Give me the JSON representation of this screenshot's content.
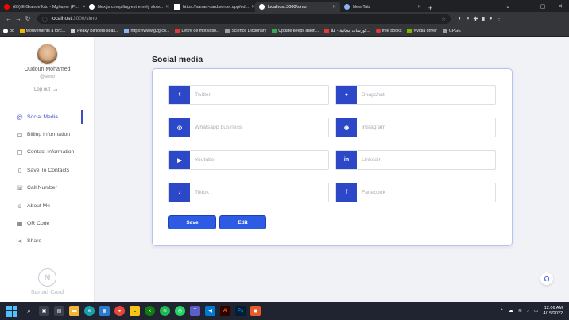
{
  "browser": {
    "tabs": [
      {
        "title": "(65) ElGrandeToto - Mghayer (Pr...",
        "active": false
      },
      {
        "title": "Nextjs compiling extremely slow...",
        "active": false
      },
      {
        "title": "https://sanad-card.vercel.app/ed...",
        "active": false
      },
      {
        "title": "localhost:3000/simo",
        "active": true
      },
      {
        "title": "New Tab",
        "active": false
      }
    ],
    "url_host": "localhost",
    "url_path": ":3000/simo",
    "bookmarks": [
      "pc",
      "Mouvements à forc...",
      "Peaky Blinders seas...",
      "https://www.g2g.co...",
      "Lettre de motivatio...",
      "Science Dictionary",
      "Update keeps askin...",
      "كورسات مجانية - علا...",
      "free books",
      "Nvidia driver",
      "CPGE"
    ]
  },
  "profile": {
    "name": "Oudoun Mohamed",
    "handle": "@simo",
    "logout_label": "Log out"
  },
  "nav": [
    {
      "label": "Social Media",
      "icon": "at-icon",
      "glyph": "@",
      "active": true
    },
    {
      "label": "Billing Information",
      "icon": "card-icon",
      "glyph": "▭",
      "active": false
    },
    {
      "label": "Contact Information",
      "icon": "chat-icon",
      "glyph": "▢",
      "active": false
    },
    {
      "label": "Save To Contacts",
      "icon": "phone-icon",
      "glyph": "▯",
      "active": false
    },
    {
      "label": "Call Number",
      "icon": "call-icon",
      "glyph": "☏",
      "active": false
    },
    {
      "label": "About Me",
      "icon": "user-icon",
      "glyph": "☺",
      "active": false
    },
    {
      "label": "QR Code",
      "icon": "qr-icon",
      "glyph": "▦",
      "active": false
    },
    {
      "label": "Share",
      "icon": "share-icon",
      "glyph": "⋖",
      "active": false
    }
  ],
  "brand": {
    "logo_letter": "N",
    "name": "Sanad Card"
  },
  "main": {
    "title": "Social media",
    "fields": [
      {
        "placeholder": "Twitter",
        "icon": "twitter-icon",
        "glyph": "t"
      },
      {
        "placeholder": "Snapchat",
        "icon": "snapchat-icon",
        "glyph": "●"
      },
      {
        "placeholder": "Whatsapp business",
        "icon": "whatsapp-icon",
        "glyph": "◎"
      },
      {
        "placeholder": "Instagram",
        "icon": "instagram-icon",
        "glyph": "◉"
      },
      {
        "placeholder": "Youtube",
        "icon": "youtube-icon",
        "glyph": "▶"
      },
      {
        "placeholder": "Linkedin",
        "icon": "linkedin-icon",
        "glyph": "in"
      },
      {
        "placeholder": "Tiktok",
        "icon": "tiktok-icon",
        "glyph": "♪"
      },
      {
        "placeholder": "Facebook",
        "icon": "facebook-icon",
        "glyph": "f"
      }
    ],
    "save_label": "Save",
    "edit_label": "Edit"
  },
  "taskbar": {
    "time": "12:06 AM",
    "date": "4/15/2022"
  },
  "colors": {
    "accent": "#2c48c9",
    "button": "#2d5be3"
  }
}
